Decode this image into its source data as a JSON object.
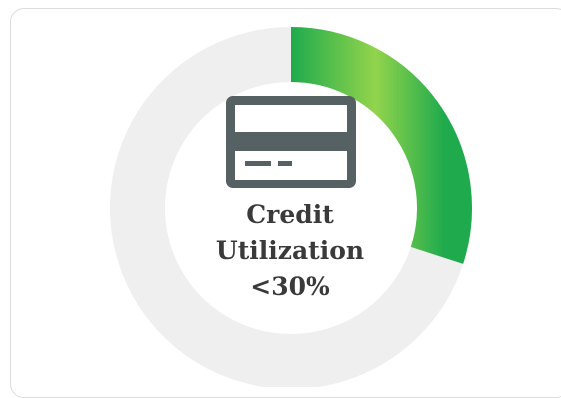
{
  "widget": {
    "title_line1": "Credit",
    "title_line2": "Utilization",
    "value_label": "<30%",
    "utilization_fraction": 0.3,
    "icon": "credit-card-icon"
  },
  "colors": {
    "track": "#efefef",
    "progress_start": "#1faa4d",
    "progress_mid": "#8fd34d",
    "icon": "#566164",
    "text": "#3a3a3a",
    "card_border": "#dcdcdc"
  }
}
